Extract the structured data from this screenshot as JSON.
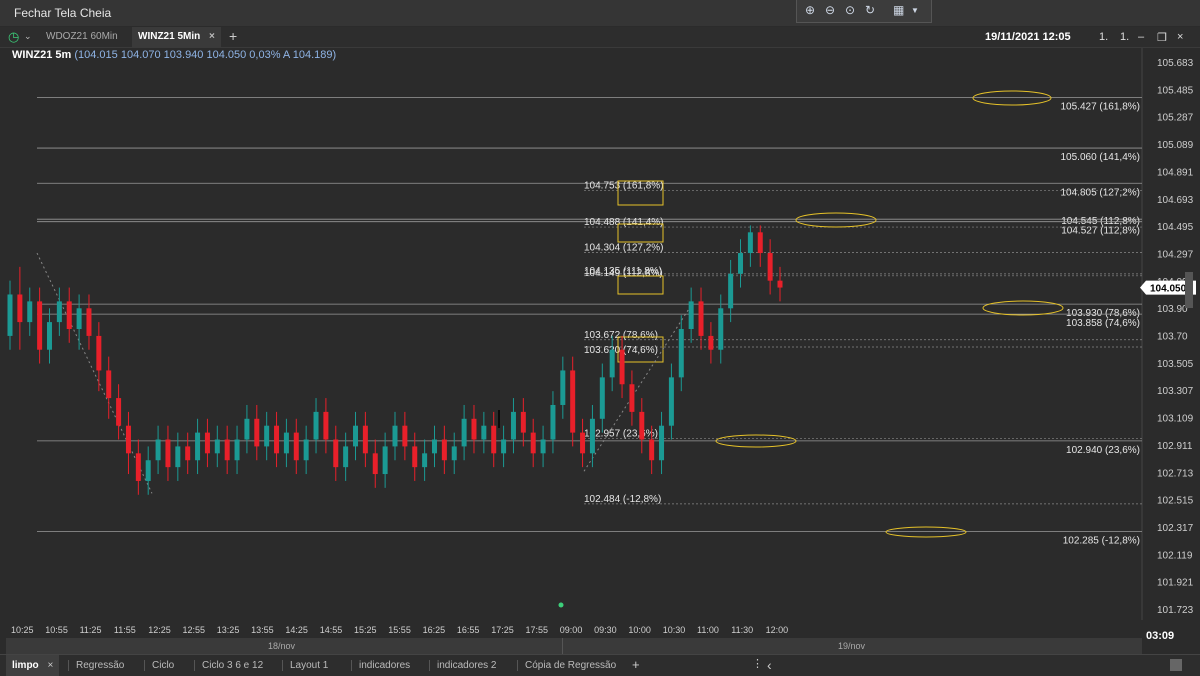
{
  "window": {
    "title": "Fechar Tela Cheia"
  },
  "tabs": [
    {
      "label": "WDOZ21 60Min",
      "active": false
    },
    {
      "label": "WINZ21 5Min",
      "active": true
    }
  ],
  "header": {
    "datetime": "19/11/2021 12:05",
    "ctrl1": "1.",
    "ctrl2": "1."
  },
  "info": {
    "symbol": "WINZ21 5m",
    "values": "(104.015  104.070  103.940  104.050  0,03%  A 104.189)"
  },
  "price_axis": [
    "105.683",
    "105.485",
    "105.287",
    "105.089",
    "104.891",
    "104.693",
    "104.495",
    "104.297",
    "104.099",
    "103.90",
    "103.70",
    "103.505",
    "103.307",
    "103.109",
    "102.911",
    "102.713",
    "102.515",
    "102.317",
    "102.119",
    "101.921",
    "101.723"
  ],
  "current_price": "104.050",
  "time_labels": [
    "10:25",
    "10:55",
    "11:25",
    "11:55",
    "12:25",
    "12:55",
    "13:25",
    "13:55",
    "14:25",
    "14:55",
    "15:25",
    "15:55",
    "16:25",
    "16:55",
    "17:25",
    "17:55",
    "09:00",
    "09:30",
    "10:00",
    "10:30",
    "11:00",
    "11:30",
    "12:00"
  ],
  "dates": [
    "18/nov",
    "19/nov"
  ],
  "clock": "03:09",
  "fib_right": [
    "105.427 (161,8%)",
    "105.060 (141,4%)",
    "104.805 (127,2%)",
    "104.545 (112,8%)",
    "104.527 (112,8%)",
    "103.930 (78,6%)",
    "103.858 (74,6%)",
    "102.940 (23,6%)",
    "102.285 (-12,8%)"
  ],
  "fib_mid": [
    "104.753 (161,8%)",
    "104.488 (141,4%)",
    "104.304 (127,2%)",
    "104.149 (112,8%)",
    "104.135 (111,8%)",
    "103.672 (78,6%)",
    "103.620 (74,6%)",
    "102.957 (23,6%)",
    "102.484 (-12,8%)"
  ],
  "bottom_tabs": [
    "limpo",
    "Regressão",
    "Ciclo",
    "Ciclo 3 6 e 12",
    "Layout 1",
    "indicadores",
    "indicadores 2",
    "Cópia de Regressão"
  ],
  "colors": {
    "up": "#1b9a94",
    "down": "#e8202a",
    "background": "#2b2b2b",
    "highlight": "#e6c229"
  },
  "chart_data": {
    "type": "candlestick",
    "candles": [
      {
        "o": 103.7,
        "c": 104.0,
        "h": 104.1,
        "l": 103.6
      },
      {
        "o": 104.0,
        "c": 103.8,
        "h": 104.2,
        "l": 103.6
      },
      {
        "o": 103.8,
        "c": 103.95,
        "h": 104.05,
        "l": 103.7
      },
      {
        "o": 103.95,
        "c": 103.6,
        "h": 104.05,
        "l": 103.5
      },
      {
        "o": 103.6,
        "c": 103.8,
        "h": 103.9,
        "l": 103.5
      },
      {
        "o": 103.8,
        "c": 103.95,
        "h": 104.05,
        "l": 103.7
      },
      {
        "o": 103.95,
        "c": 103.75,
        "h": 104.05,
        "l": 103.65
      },
      {
        "o": 103.75,
        "c": 103.9,
        "h": 104.0,
        "l": 103.6
      },
      {
        "o": 103.9,
        "c": 103.7,
        "h": 104.0,
        "l": 103.6
      },
      {
        "o": 103.7,
        "c": 103.45,
        "h": 103.8,
        "l": 103.3
      },
      {
        "o": 103.45,
        "c": 103.25,
        "h": 103.55,
        "l": 103.1
      },
      {
        "o": 103.25,
        "c": 103.05,
        "h": 103.35,
        "l": 102.95
      },
      {
        "o": 103.05,
        "c": 102.85,
        "h": 103.15,
        "l": 102.7
      },
      {
        "o": 102.85,
        "c": 102.65,
        "h": 102.95,
        "l": 102.55
      },
      {
        "o": 102.65,
        "c": 102.8,
        "h": 102.9,
        "l": 102.55
      },
      {
        "o": 102.8,
        "c": 102.95,
        "h": 103.05,
        "l": 102.7
      },
      {
        "o": 102.95,
        "c": 102.75,
        "h": 103.05,
        "l": 102.65
      },
      {
        "o": 102.75,
        "c": 102.9,
        "h": 103.0,
        "l": 102.65
      },
      {
        "o": 102.9,
        "c": 102.8,
        "h": 103.0,
        "l": 102.7
      },
      {
        "o": 102.8,
        "c": 103.0,
        "h": 103.1,
        "l": 102.7
      },
      {
        "o": 103.0,
        "c": 102.85,
        "h": 103.1,
        "l": 102.75
      },
      {
        "o": 102.85,
        "c": 102.95,
        "h": 103.05,
        "l": 102.75
      },
      {
        "o": 102.95,
        "c": 102.8,
        "h": 103.05,
        "l": 102.7
      },
      {
        "o": 102.8,
        "c": 102.95,
        "h": 103.05,
        "l": 102.7
      },
      {
        "o": 102.95,
        "c": 103.1,
        "h": 103.2,
        "l": 102.85
      },
      {
        "o": 103.1,
        "c": 102.9,
        "h": 103.2,
        "l": 102.8
      },
      {
        "o": 102.9,
        "c": 103.05,
        "h": 103.15,
        "l": 102.8
      },
      {
        "o": 103.05,
        "c": 102.85,
        "h": 103.15,
        "l": 102.75
      },
      {
        "o": 102.85,
        "c": 103.0,
        "h": 103.1,
        "l": 102.75
      },
      {
        "o": 103.0,
        "c": 102.8,
        "h": 103.1,
        "l": 102.7
      },
      {
        "o": 102.8,
        "c": 102.95,
        "h": 103.05,
        "l": 102.7
      },
      {
        "o": 102.95,
        "c": 103.15,
        "h": 103.25,
        "l": 102.85
      },
      {
        "o": 103.15,
        "c": 102.95,
        "h": 103.25,
        "l": 102.85
      },
      {
        "o": 102.95,
        "c": 102.75,
        "h": 103.05,
        "l": 102.65
      },
      {
        "o": 102.75,
        "c": 102.9,
        "h": 103.0,
        "l": 102.65
      },
      {
        "o": 102.9,
        "c": 103.05,
        "h": 103.15,
        "l": 102.8
      },
      {
        "o": 103.05,
        "c": 102.85,
        "h": 103.15,
        "l": 102.75
      },
      {
        "o": 102.85,
        "c": 102.7,
        "h": 102.95,
        "l": 102.6
      },
      {
        "o": 102.7,
        "c": 102.9,
        "h": 103.0,
        "l": 102.6
      },
      {
        "o": 102.9,
        "c": 103.05,
        "h": 103.15,
        "l": 102.8
      },
      {
        "o": 103.05,
        "c": 102.9,
        "h": 103.15,
        "l": 102.8
      },
      {
        "o": 102.9,
        "c": 102.75,
        "h": 103.0,
        "l": 102.65
      },
      {
        "o": 102.75,
        "c": 102.85,
        "h": 102.95,
        "l": 102.65
      },
      {
        "o": 102.85,
        "c": 102.95,
        "h": 103.05,
        "l": 102.75
      },
      {
        "o": 102.95,
        "c": 102.8,
        "h": 103.05,
        "l": 102.7
      },
      {
        "o": 102.8,
        "c": 102.9,
        "h": 103.0,
        "l": 102.7
      },
      {
        "o": 102.9,
        "c": 103.1,
        "h": 103.2,
        "l": 102.8
      },
      {
        "o": 103.1,
        "c": 102.95,
        "h": 103.2,
        "l": 102.85
      },
      {
        "o": 102.95,
        "c": 103.05,
        "h": 103.15,
        "l": 102.85
      },
      {
        "o": 103.05,
        "c": 102.85,
        "h": 103.15,
        "l": 102.75
      },
      {
        "o": 102.85,
        "c": 102.95,
        "h": 103.05,
        "l": 102.75
      },
      {
        "o": 102.95,
        "c": 103.15,
        "h": 103.25,
        "l": 102.85
      },
      {
        "o": 103.15,
        "c": 103.0,
        "h": 103.25,
        "l": 102.9
      },
      {
        "o": 103.0,
        "c": 102.85,
        "h": 103.1,
        "l": 102.75
      },
      {
        "o": 102.85,
        "c": 102.95,
        "h": 103.05,
        "l": 102.75
      },
      {
        "o": 102.95,
        "c": 103.2,
        "h": 103.3,
        "l": 102.85
      },
      {
        "o": 103.2,
        "c": 103.45,
        "h": 103.55,
        "l": 103.1
      },
      {
        "o": 103.45,
        "c": 103.0,
        "h": 103.55,
        "l": 102.9
      },
      {
        "o": 103.0,
        "c": 102.85,
        "h": 103.1,
        "l": 102.75
      },
      {
        "o": 102.85,
        "c": 103.1,
        "h": 103.2,
        "l": 102.75
      },
      {
        "o": 103.1,
        "c": 103.4,
        "h": 103.5,
        "l": 103.0
      },
      {
        "o": 103.4,
        "c": 103.6,
        "h": 103.7,
        "l": 103.3
      },
      {
        "o": 103.6,
        "c": 103.35,
        "h": 103.7,
        "l": 103.25
      },
      {
        "o": 103.35,
        "c": 103.15,
        "h": 103.45,
        "l": 103.05
      },
      {
        "o": 103.15,
        "c": 102.95,
        "h": 103.25,
        "l": 102.85
      },
      {
        "o": 102.95,
        "c": 102.8,
        "h": 103.05,
        "l": 102.7
      },
      {
        "o": 102.8,
        "c": 103.05,
        "h": 103.15,
        "l": 102.7
      },
      {
        "o": 103.05,
        "c": 103.4,
        "h": 103.5,
        "l": 102.95
      },
      {
        "o": 103.4,
        "c": 103.75,
        "h": 103.85,
        "l": 103.3
      },
      {
        "o": 103.75,
        "c": 103.95,
        "h": 104.05,
        "l": 103.65
      },
      {
        "o": 103.95,
        "c": 103.7,
        "h": 104.05,
        "l": 103.6
      },
      {
        "o": 103.7,
        "c": 103.6,
        "h": 103.8,
        "l": 103.5
      },
      {
        "o": 103.6,
        "c": 103.9,
        "h": 104.0,
        "l": 103.5
      },
      {
        "o": 103.9,
        "c": 104.15,
        "h": 104.25,
        "l": 103.8
      },
      {
        "o": 104.15,
        "c": 104.3,
        "h": 104.4,
        "l": 104.05
      },
      {
        "o": 104.3,
        "c": 104.45,
        "h": 104.5,
        "l": 104.2
      },
      {
        "o": 104.45,
        "c": 104.3,
        "h": 104.5,
        "l": 104.2
      },
      {
        "o": 104.3,
        "c": 104.1,
        "h": 104.4,
        "l": 104.0
      },
      {
        "o": 104.1,
        "c": 104.05,
        "h": 104.2,
        "l": 103.95
      }
    ]
  }
}
